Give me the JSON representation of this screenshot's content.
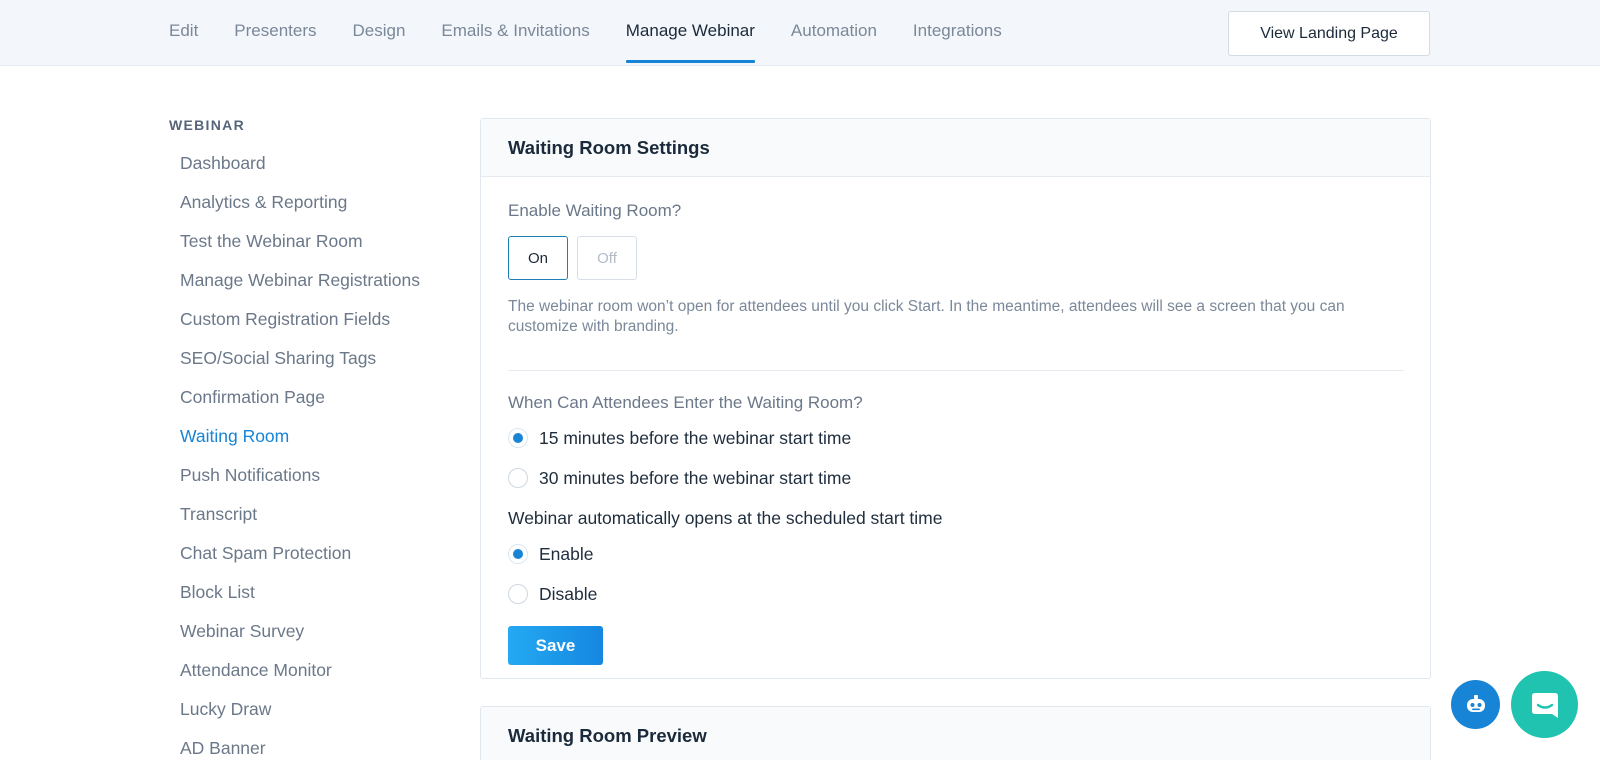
{
  "nav": {
    "tabs": [
      {
        "label": "Edit"
      },
      {
        "label": "Presenters"
      },
      {
        "label": "Design"
      },
      {
        "label": "Emails & Invitations"
      },
      {
        "label": "Manage Webinar"
      },
      {
        "label": "Automation"
      },
      {
        "label": "Integrations"
      }
    ],
    "active_tab": "Manage Webinar",
    "view_landing_label": "View Landing Page"
  },
  "sidebar": {
    "heading": "WEBINAR",
    "items": [
      {
        "label": "Dashboard"
      },
      {
        "label": "Analytics & Reporting"
      },
      {
        "label": "Test the Webinar Room"
      },
      {
        "label": "Manage Webinar Registrations"
      },
      {
        "label": "Custom Registration Fields"
      },
      {
        "label": "SEO/Social Sharing Tags"
      },
      {
        "label": "Confirmation Page"
      },
      {
        "label": "Waiting Room"
      },
      {
        "label": "Push Notifications"
      },
      {
        "label": "Transcript"
      },
      {
        "label": "Chat Spam Protection"
      },
      {
        "label": "Block List"
      },
      {
        "label": "Webinar Survey"
      },
      {
        "label": "Attendance Monitor"
      },
      {
        "label": "Lucky Draw"
      },
      {
        "label": "AD Banner"
      }
    ],
    "active_item": "Waiting Room"
  },
  "settings": {
    "title": "Waiting Room Settings",
    "enable_label": "Enable Waiting Room?",
    "on_label": "On",
    "off_label": "Off",
    "enabled": "On",
    "description": "The webinar room won’t open for attendees until you click Start. In the meantime, attendees will see a screen that you can customize with branding.",
    "when_label": "When Can Attendees Enter the Waiting Room?",
    "when_options": [
      {
        "label": "15 minutes before the webinar start time",
        "checked": true
      },
      {
        "label": "30 minutes before the webinar start time",
        "checked": false
      }
    ],
    "auto_open_label": "Webinar automatically opens at the scheduled start time",
    "auto_open_options": [
      {
        "label": "Enable",
        "checked": true
      },
      {
        "label": "Disable",
        "checked": false
      }
    ],
    "save_label": "Save"
  },
  "preview": {
    "title": "Waiting Room Preview"
  },
  "colors": {
    "accent": "#1784d6",
    "chat_fab": "#20c3b0"
  },
  "icons": {
    "bot": "robot-icon",
    "chat": "chat-bubble-icon"
  }
}
